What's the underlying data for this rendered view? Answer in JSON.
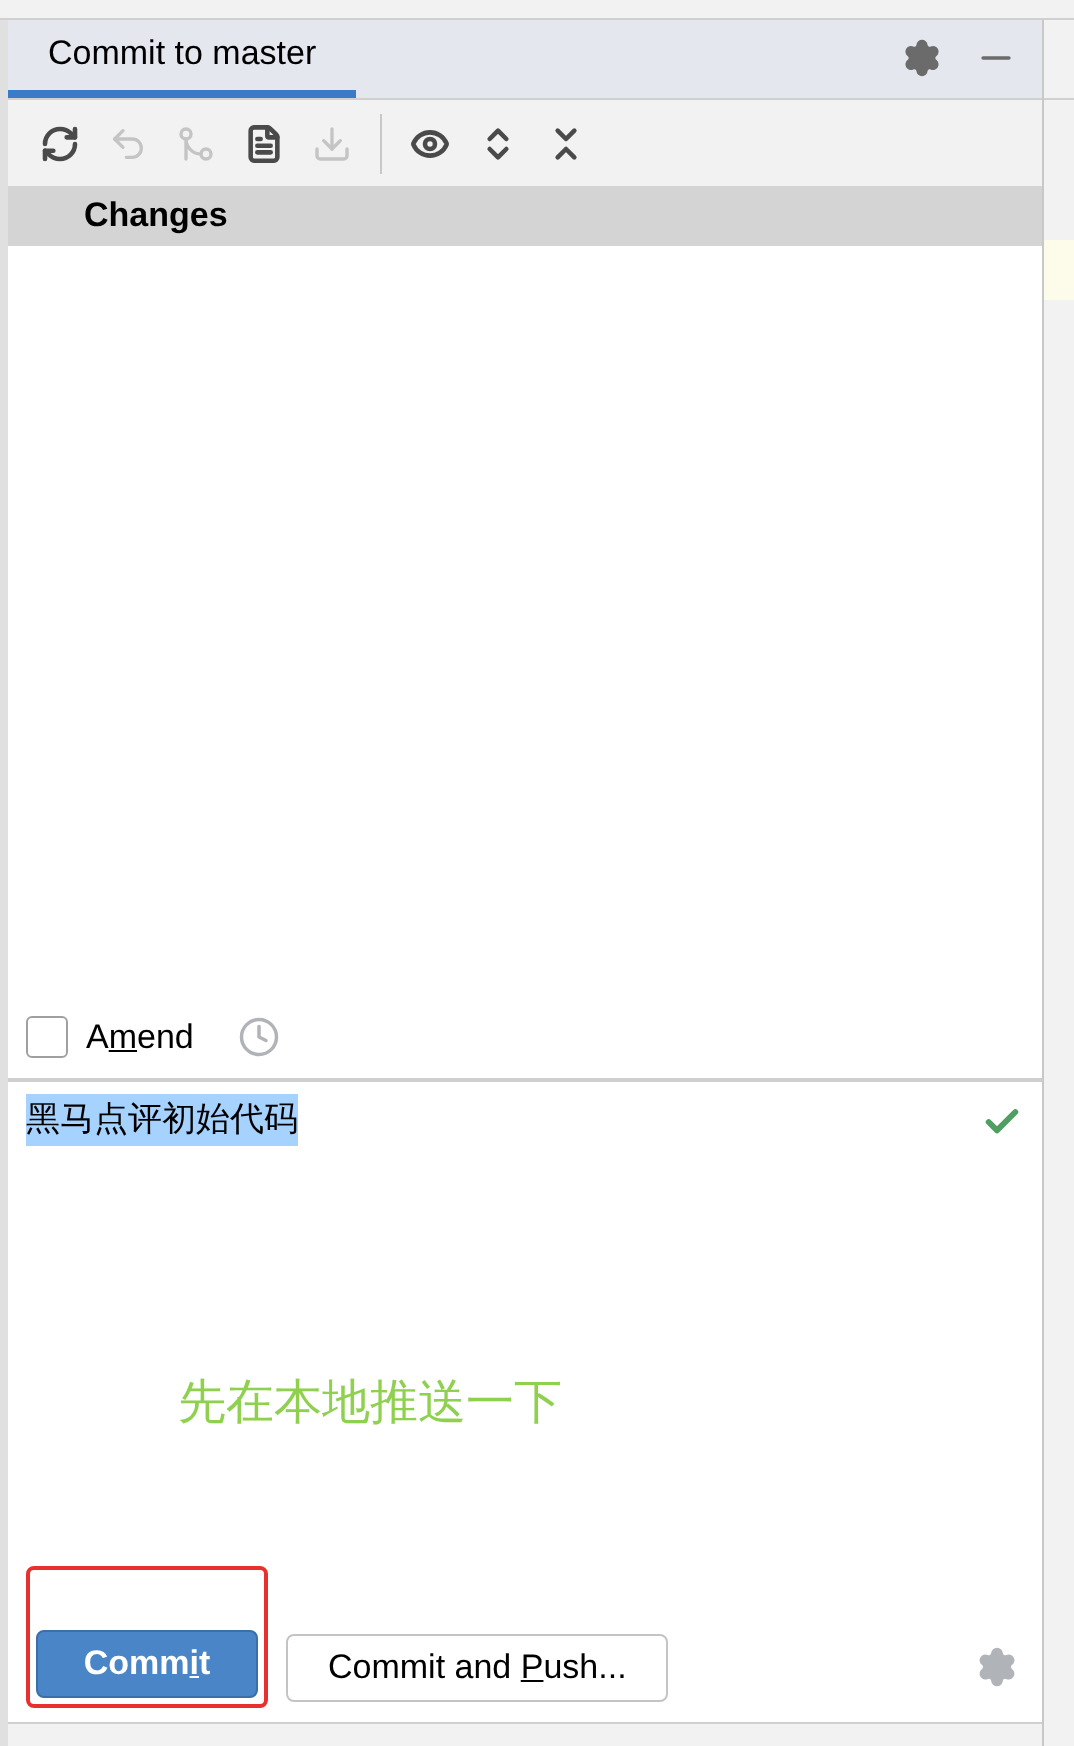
{
  "tab": {
    "label": "Commit to master",
    "selected": true
  },
  "toolbar": [
    {
      "kind": "refresh",
      "disabled": false
    },
    {
      "kind": "undo",
      "disabled": true
    },
    {
      "kind": "merge",
      "disabled": true
    },
    {
      "kind": "list",
      "disabled": false
    },
    {
      "kind": "download",
      "disabled": true
    },
    {
      "kind": "separator"
    },
    {
      "kind": "eye",
      "disabled": false
    },
    {
      "kind": "expand",
      "disabled": false
    },
    {
      "kind": "collapse",
      "disabled": false
    }
  ],
  "changes": {
    "title": "Changes"
  },
  "amend": {
    "label_parts": [
      "A",
      "m",
      "end"
    ],
    "checked": false
  },
  "message": {
    "value": "黑马点评初始代码",
    "selected": true,
    "valid": true
  },
  "annotation": {
    "text": "先在本地推送一下",
    "color": "#8fd14f"
  },
  "buttons": [
    {
      "label_parts": [
        "Comm",
        "i",
        "t"
      ],
      "kind": "primary",
      "highlighted": true
    },
    {
      "label_parts": [
        "Commit and ",
        "P",
        "ush..."
      ],
      "kind": "secondary",
      "highlighted": false
    }
  ]
}
